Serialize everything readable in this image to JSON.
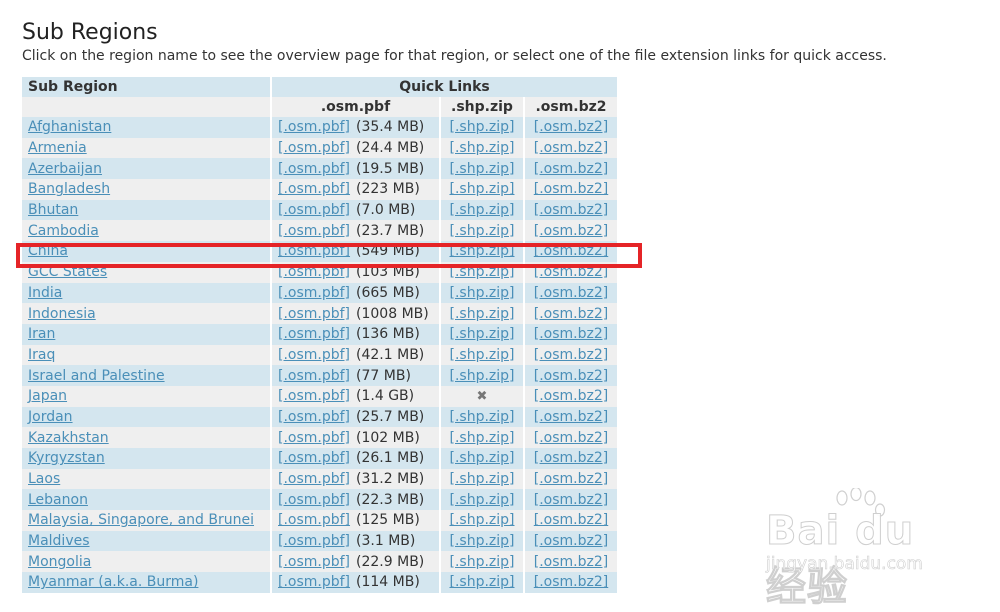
{
  "page": {
    "title": "Sub Regions",
    "subtitle": "Click on the region name to see the overview page for that region, or select one of the file extension links for quick access."
  },
  "table": {
    "header": {
      "sub_region": "Sub Region",
      "quick_links": "Quick Links",
      "col_pbf": ".osm.pbf",
      "col_shp": ".shp.zip",
      "col_bz2": ".osm.bz2"
    },
    "link_labels": {
      "pbf": "[.osm.pbf]",
      "shp": "[.shp.zip]",
      "bz2": "[.osm.bz2]"
    },
    "rows": [
      {
        "name": "Afghanistan",
        "size": "(35.4 MB)",
        "shp": true
      },
      {
        "name": "Armenia",
        "size": "(24.4 MB)",
        "shp": true
      },
      {
        "name": "Azerbaijan",
        "size": "(19.5 MB)",
        "shp": true
      },
      {
        "name": "Bangladesh",
        "size": "(223 MB)",
        "shp": true
      },
      {
        "name": "Bhutan",
        "size": "(7.0 MB)",
        "shp": true
      },
      {
        "name": "Cambodia",
        "size": "(23.7 MB)",
        "shp": true
      },
      {
        "name": "China",
        "size": "(549 MB)",
        "shp": true
      },
      {
        "name": "GCC States",
        "size": "(103 MB)",
        "shp": true
      },
      {
        "name": "India",
        "size": "(665 MB)",
        "shp": true
      },
      {
        "name": "Indonesia",
        "size": "(1008 MB)",
        "shp": true
      },
      {
        "name": "Iran",
        "size": "(136 MB)",
        "shp": true
      },
      {
        "name": "Iraq",
        "size": "(42.1 MB)",
        "shp": true
      },
      {
        "name": "Israel and Palestine",
        "size": "(77 MB)",
        "shp": true
      },
      {
        "name": "Japan",
        "size": "(1.4 GB)",
        "shp": false
      },
      {
        "name": "Jordan",
        "size": "(25.7 MB)",
        "shp": true
      },
      {
        "name": "Kazakhstan",
        "size": "(102 MB)",
        "shp": true
      },
      {
        "name": "Kyrgyzstan",
        "size": "(26.1 MB)",
        "shp": true
      },
      {
        "name": "Laos",
        "size": "(31.2 MB)",
        "shp": true
      },
      {
        "name": "Lebanon",
        "size": "(22.3 MB)",
        "shp": true
      },
      {
        "name": "Malaysia, Singapore, and Brunei",
        "size": "(125 MB)",
        "shp": true
      },
      {
        "name": "Maldives",
        "size": "(3.1 MB)",
        "shp": true
      },
      {
        "name": "Mongolia",
        "size": "(22.9 MB)",
        "shp": true
      },
      {
        "name": "Myanmar (a.k.a. Burma)",
        "size": "(114 MB)",
        "shp": true
      }
    ]
  },
  "annotation": {
    "highlighted_row": "China",
    "color": "#e52427"
  },
  "watermark": {
    "brand": "Bai du 经验",
    "url": "jingyan.baidu.com"
  },
  "colors": {
    "link": "#4a8fb8",
    "row_blue": "#d4e6ef",
    "row_gray": "#efefef"
  }
}
